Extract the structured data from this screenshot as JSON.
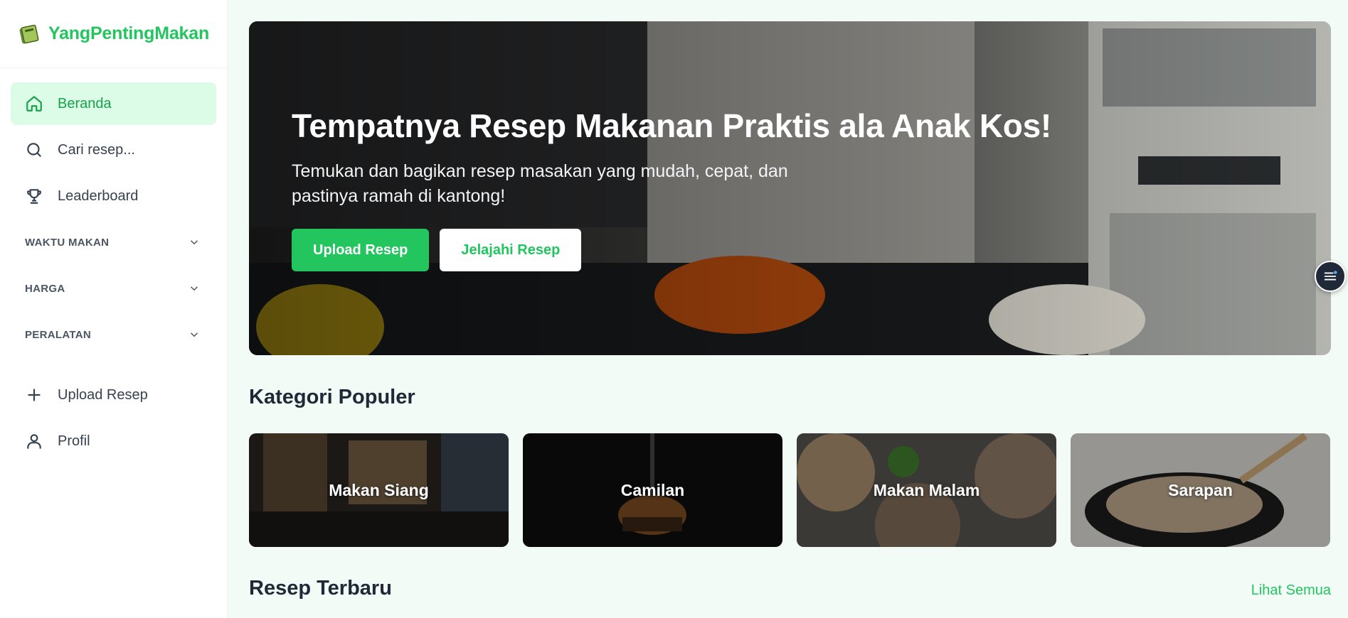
{
  "brand": {
    "name": "YangPentingMakan"
  },
  "sidebar": {
    "nav": [
      {
        "label": "Beranda",
        "icon": "home-icon",
        "active": true
      },
      {
        "label": "Cari resep...",
        "icon": "search-icon"
      },
      {
        "label": "Leaderboard",
        "icon": "trophy-icon"
      }
    ],
    "sections": [
      {
        "label": "WAKTU MAKAN"
      },
      {
        "label": "HARGA"
      },
      {
        "label": "PERALATAN"
      }
    ],
    "bottom": [
      {
        "label": "Upload Resep",
        "icon": "plus-icon"
      },
      {
        "label": "Profil",
        "icon": "user-icon"
      }
    ]
  },
  "hero": {
    "title": "Tempatnya Resep Makanan Praktis ala Anak Kos!",
    "subtitle": "Temukan dan bagikan resep masakan yang mudah, cepat, dan pastinya ramah di kantong!",
    "primary_button": "Upload Resep",
    "secondary_button": "Jelajahi Resep"
  },
  "categories": {
    "heading": "Kategori Populer",
    "items": [
      {
        "label": "Makan Siang"
      },
      {
        "label": "Camilan"
      },
      {
        "label": "Makan Malam"
      },
      {
        "label": "Sarapan"
      }
    ]
  },
  "latest": {
    "heading": "Resep Terbaru",
    "see_all": "Lihat Semua"
  },
  "colors": {
    "accent": "#22c55e",
    "active_bg": "#dcfce7",
    "page_bg": "#f2fbf5",
    "heading": "#1f2937"
  }
}
